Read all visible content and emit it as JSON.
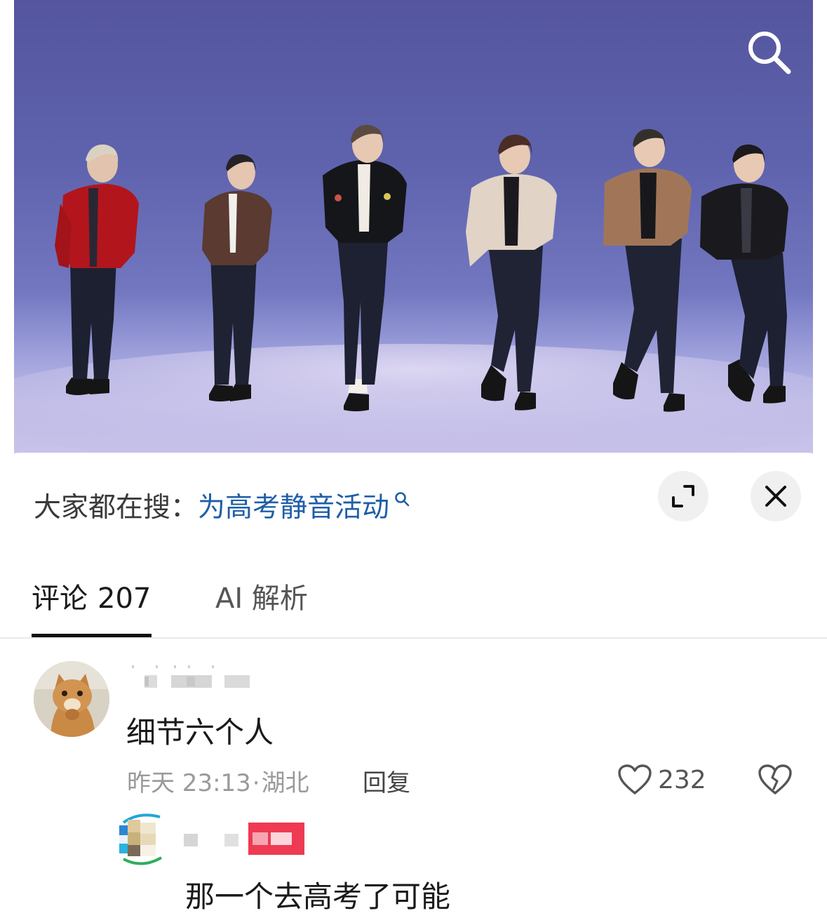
{
  "video": {
    "icons": {
      "search": "search-icon"
    }
  },
  "hot_search": {
    "prefix": "大家都在搜：",
    "query": "为高考静音活动",
    "icons": {
      "search": "search-icon",
      "expand": "expand-icon",
      "close": "close-icon"
    }
  },
  "tabs": [
    {
      "label": "评论",
      "count": "207",
      "active": true
    },
    {
      "label": "AI 解析",
      "active": false
    }
  ],
  "comments": [
    {
      "avatar": "cat-avatar",
      "text": "细节六个人",
      "time": "昨天 23:13",
      "location": "湖北",
      "reply_label": "回复",
      "likes": "232",
      "icons": {
        "like": "heart-icon",
        "dislike": "broken-heart-icon"
      },
      "replies": [
        {
          "text": "那一个去高考了可能"
        }
      ]
    }
  ],
  "colors": {
    "link": "#1f5ea8",
    "text": "#1a1a1a",
    "muted": "#9a9a9a",
    "stage_top": "#54559e",
    "stage_floor": "#cbc4ea"
  }
}
